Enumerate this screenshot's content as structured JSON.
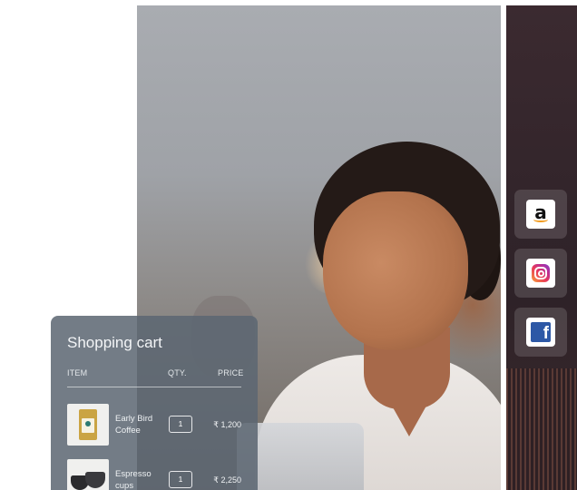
{
  "cart": {
    "title": "Shopping cart",
    "headers": {
      "item": "ITEM",
      "qty": "QTY.",
      "price": "PRICE"
    },
    "items": [
      {
        "name_line1": "Early Bird",
        "name_line2": "Coffee",
        "qty": "1",
        "price": "₹ 1,200"
      },
      {
        "name_line1": "Espresso",
        "name_line2": "cups",
        "qty": "1",
        "price": "₹ 2,250"
      }
    ]
  },
  "social": [
    {
      "name": "amazon",
      "icon": "amazon-icon",
      "glyph": "a"
    },
    {
      "name": "instagram",
      "icon": "instagram-icon"
    },
    {
      "name": "facebook",
      "icon": "facebook-icon",
      "glyph": "f"
    }
  ],
  "colors": {
    "card_bg": "#5c6772",
    "side_panel": "#2e2228",
    "facebook": "#2d58a6",
    "amazon_smile": "#f29a1c"
  }
}
